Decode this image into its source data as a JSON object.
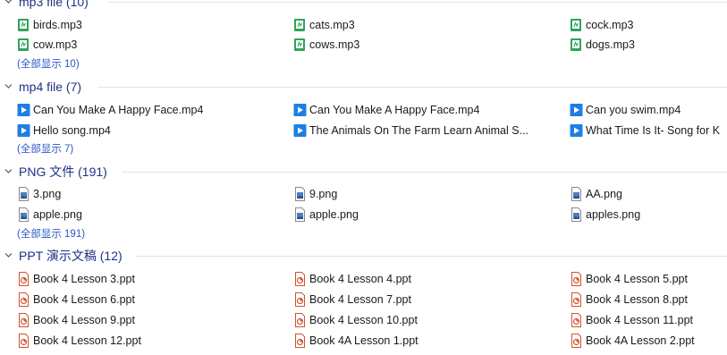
{
  "colors": {
    "header_text": "#1e3287",
    "link": "#2b58c7",
    "divider": "#e2e2e2",
    "audio_icon": "#2fa35a",
    "video_icon": "#1e7fe0",
    "ppt_icon": "#d35230"
  },
  "groups": [
    {
      "title": "mp3 file (10)",
      "icon": "audio-file-icon",
      "items": [
        "birds.mp3",
        "cats.mp3",
        "cock.mp3",
        "cow.mp3",
        "cows.mp3",
        "dogs.mp3"
      ],
      "show_all": "(全部显示 10)"
    },
    {
      "title": "mp4 file (7)",
      "icon": "video-file-icon",
      "items": [
        "Can You Make A Happy Face.mp4",
        "Can You Make A Happy Face.mp4",
        "Can you swim.mp4",
        "Hello song.mp4",
        "The Animals On The Farm  Learn Animal S...",
        "What Time Is It- Song for K"
      ],
      "show_all": "(全部显示 7)"
    },
    {
      "title": "PNG 文件 (191)",
      "icon": "image-file-icon",
      "items": [
        "3.png",
        "9.png",
        "AA.png",
        "apple.png",
        "apple.png",
        "apples.png"
      ],
      "show_all": "(全部显示 191)"
    },
    {
      "title": "PPT 演示文稿 (12)",
      "icon": "ppt-file-icon",
      "items": [
        "Book 4 Lesson 3.ppt",
        "Book 4 Lesson 4.ppt",
        "Book 4 Lesson 5.ppt",
        "Book 4 Lesson 6.ppt",
        "Book 4 Lesson 7.ppt",
        "Book 4 Lesson 8.ppt",
        "Book 4 Lesson 9.ppt",
        "Book 4 Lesson 10.ppt",
        "Book 4 Lesson 11.ppt",
        "Book 4 Lesson 12.ppt",
        "Book 4A Lesson 1.ppt",
        "Book 4A Lesson 2.ppt"
      ],
      "show_all": ""
    }
  ]
}
